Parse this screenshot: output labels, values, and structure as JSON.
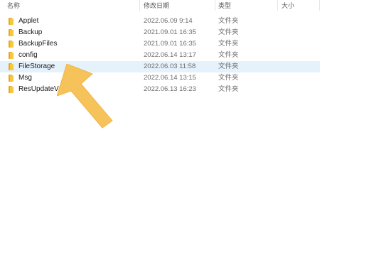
{
  "columns": {
    "name": "名称",
    "date_modified": "修改日期",
    "type": "类型",
    "size": "大小"
  },
  "files": [
    {
      "name": "Applet",
      "date": "2022.06.09 9:14",
      "type": "文件夹",
      "icon": "folder-icon"
    },
    {
      "name": "Backup",
      "date": "2021.09.01 16:35",
      "type": "文件夹",
      "icon": "folder-icon"
    },
    {
      "name": "BackupFiles",
      "date": "2021.09.01 16:35",
      "type": "文件夹",
      "icon": "folder-icon"
    },
    {
      "name": "config",
      "date": "2022.06.14 13:17",
      "type": "文件夹",
      "icon": "folder-icon"
    },
    {
      "name": "FileStorage",
      "date": "2022.06.03 11:58",
      "type": "文件夹",
      "icon": "folder-icon",
      "selected": true
    },
    {
      "name": "Msg",
      "date": "2022.06.14 13:15",
      "type": "文件夹",
      "icon": "folder-icon"
    },
    {
      "name": "ResUpdateV2",
      "date": "2022.06.13 16:23",
      "type": "文件夹",
      "icon": "folder-icon"
    }
  ],
  "colors": {
    "selection": "#e5f1fb",
    "folder": "#f8c83c",
    "annotation_arrow": "#f6c35a"
  }
}
